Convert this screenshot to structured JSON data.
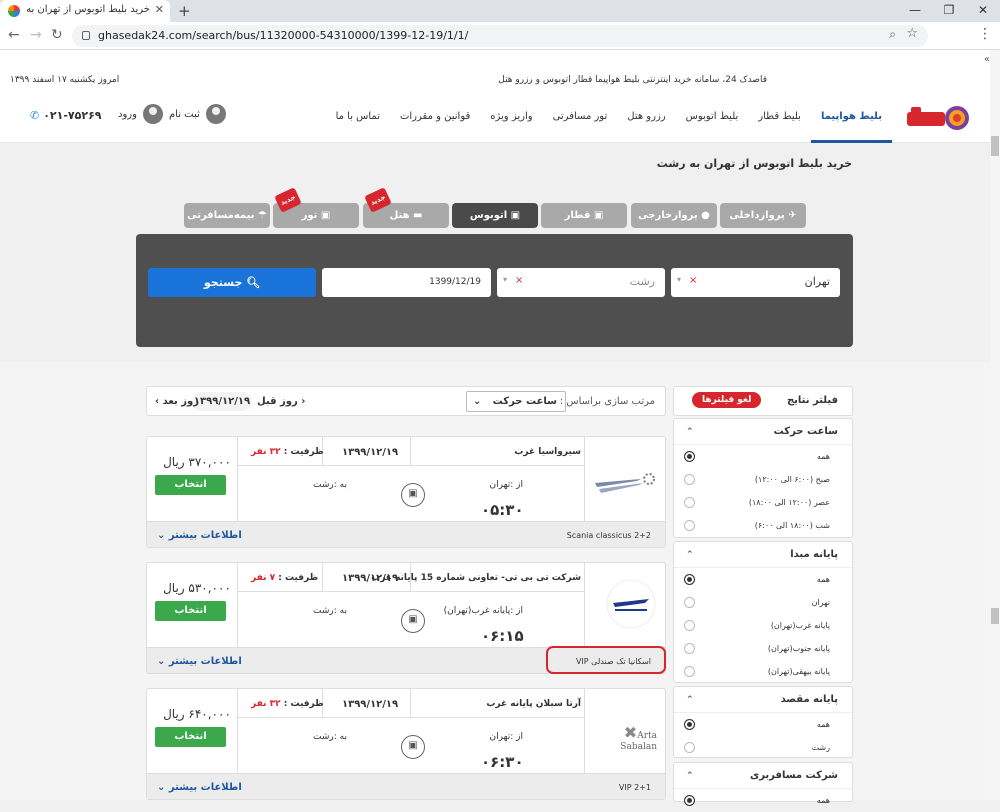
{
  "browser": {
    "tab_title": "خرید بلیط اتوبوس از تهران به رشت",
    "tab_close": "✕",
    "new_tab": "+",
    "url": "ghasedak24.com/search/bus/11320000-54310000/1399-12-19/1/1/",
    "win_min": "—",
    "win_max": "❐",
    "win_close": "✕"
  },
  "topbar": {
    "tagline": "قاصدک 24، سامانه خرید اینترنتی بلیط هواپیما قطار اتوبوس و رزرو هتل",
    "today": "امروز یکشنبه ۱۷ اسفند ۱۳۹۹",
    "scroll_hint": "«"
  },
  "menu": [
    {
      "label": "بلیط هواپیما",
      "active": true
    },
    {
      "label": "بلیط قطار",
      "active": false
    },
    {
      "label": "بلیط اتوبوس",
      "active": false
    },
    {
      "label": "رزرو هتل",
      "active": false
    },
    {
      "label": "تور مسافرتی",
      "active": false
    },
    {
      "label": "واریز ویژه",
      "active": false
    },
    {
      "label": "قوانین و مقررات",
      "active": false
    },
    {
      "label": "تماس با ما",
      "active": false
    }
  ],
  "user": {
    "signup": "ثبت نام",
    "login": "ورود",
    "phone": "۰۲۱-۷۵۲۶۹"
  },
  "page_title": "خرید بلیط اتوبوس از تهران به رشت",
  "type_tabs": [
    {
      "label": "✈ پروازداخلی",
      "active": false
    },
    {
      "label": "● پروازخارجی",
      "active": false
    },
    {
      "label": "▣ قطار",
      "active": false
    },
    {
      "label": "▣ اتوبوس",
      "active": true
    },
    {
      "label": "▬ هتل",
      "active": false,
      "badge": "جدید"
    },
    {
      "label": "▣ تور",
      "active": false,
      "badge": "جدید"
    },
    {
      "label": "☂ بیمه‌مسافرتی",
      "active": false
    }
  ],
  "search": {
    "origin": "تهران",
    "destination": "رشت",
    "date": "1399/12/19",
    "clear": "×",
    "caret": "▾",
    "button": "جستجو"
  },
  "sort": {
    "label": "مرتب سازی براساس :",
    "value": "ساعت حرکت",
    "prev_day": "روز قبل",
    "next_day": "روز بعد",
    "date": "۱۳۹۹/۱۲/۱۹"
  },
  "filters": {
    "title": "فیلتر نتایج",
    "clear": "لغو فیلترها",
    "groups": [
      {
        "title": "ساعت حرکت",
        "options": [
          {
            "label": "همه",
            "selected": true
          },
          {
            "label": "صبح (۶:۰۰ الی ۱۲:۰۰)",
            "selected": false
          },
          {
            "label": "عصر (۱۲:۰۰ الی ۱۸:۰۰)",
            "selected": false
          },
          {
            "label": "شب (۱۸:۰۰ الی ۶:۰۰)",
            "selected": false
          }
        ]
      },
      {
        "title": "پایانه مبدا",
        "options": [
          {
            "label": "همه",
            "selected": true
          },
          {
            "label": "تهران",
            "selected": false
          },
          {
            "label": "پایانه غرب(تهران)",
            "selected": false
          },
          {
            "label": "پایانه جنوب(تهران)",
            "selected": false
          },
          {
            "label": "پایانه بیهقی(تهران)",
            "selected": false
          }
        ]
      },
      {
        "title": "پایانه مقصد",
        "options": [
          {
            "label": "همه",
            "selected": true
          },
          {
            "label": "رشت",
            "selected": false
          }
        ]
      },
      {
        "title": "شرکت مسافربری",
        "options": [
          {
            "label": "همه",
            "selected": true
          }
        ]
      }
    ]
  },
  "results": [
    {
      "company": "سیرواسیا غرب",
      "date": "۱۳۹۹/۱۲/۱۹",
      "capacity_label": "ظرفیت :",
      "capacity": "۳۲ نفر",
      "from": "از :تهران",
      "to": "به :رشت",
      "time": "۰۵:۳۰",
      "price": "۳۷۰,۰۰۰ ریال",
      "select": "انتخاب",
      "feature": "Scania classicus 2+2",
      "more": "اطلاعات بیشتر"
    },
    {
      "company": "شرکت تی بی تی- تعاونی شماره 15 پایانه غرب",
      "date": "۱۳۹۹/۱۲/۱۹",
      "capacity_label": "ظرفیت :",
      "capacity": "۷ نفر",
      "from": "از :پایانه غرب(تهران)",
      "to": "به :رشت",
      "time": "۰۶:۱۵",
      "price": "۵۳۰,۰۰۰ ریال",
      "select": "انتخاب",
      "feature": "اسکانیا تک صندلی VIP",
      "more": "اطلاعات بیشتر"
    },
    {
      "company": "آرتا سبلان پایانه غرب",
      "date": "۱۳۹۹/۱۲/۱۹",
      "capacity_label": "ظرفیت :",
      "capacity": "۳۲ نفر",
      "from": "از :تهران",
      "to": "به :رشت",
      "time": "۰۶:۳۰",
      "price": "۶۴۰,۰۰۰ ریال",
      "select": "انتخاب",
      "feature": "VIP 2+1",
      "more": "اطلاعات بیشتر",
      "logo_text": "Arta Sabalan"
    }
  ]
}
